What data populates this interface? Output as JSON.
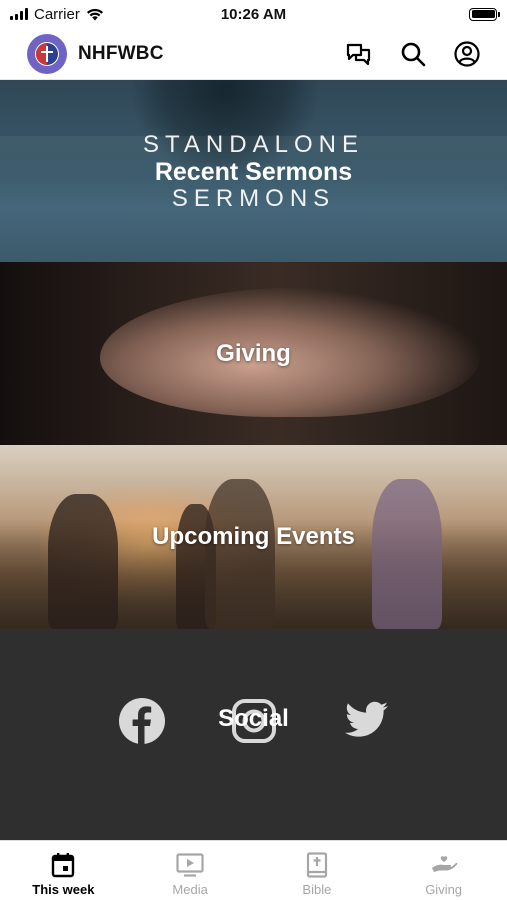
{
  "status_bar": {
    "carrier": "Carrier",
    "time": "10:26 AM"
  },
  "header": {
    "title": "NHFWBC",
    "avatar_color": "#6f63c4",
    "actions": [
      {
        "icon": "chat-icon"
      },
      {
        "icon": "search-icon"
      },
      {
        "icon": "account-icon"
      }
    ]
  },
  "tiles": {
    "sermons": {
      "line_top": "STANDALONE",
      "title": "Recent Sermons",
      "line_bottom": "SERMONS"
    },
    "giving": {
      "title": "Giving"
    },
    "events": {
      "title": "Upcoming Events"
    },
    "social": {
      "title": "Social",
      "icons": [
        "facebook-icon",
        "instagram-icon",
        "twitter-icon"
      ]
    }
  },
  "tab_bar": {
    "tabs": [
      {
        "label": "This week",
        "icon": "calendar-icon",
        "active": true
      },
      {
        "label": "Media",
        "icon": "play-icon",
        "active": false
      },
      {
        "label": "Bible",
        "icon": "bible-icon",
        "active": false
      },
      {
        "label": "Giving",
        "icon": "giving-hand-icon",
        "active": false
      }
    ]
  },
  "colors": {
    "active_tab": "#000000",
    "inactive_tab": "#a6a6a6",
    "social_bg": "#2f2f2f"
  }
}
